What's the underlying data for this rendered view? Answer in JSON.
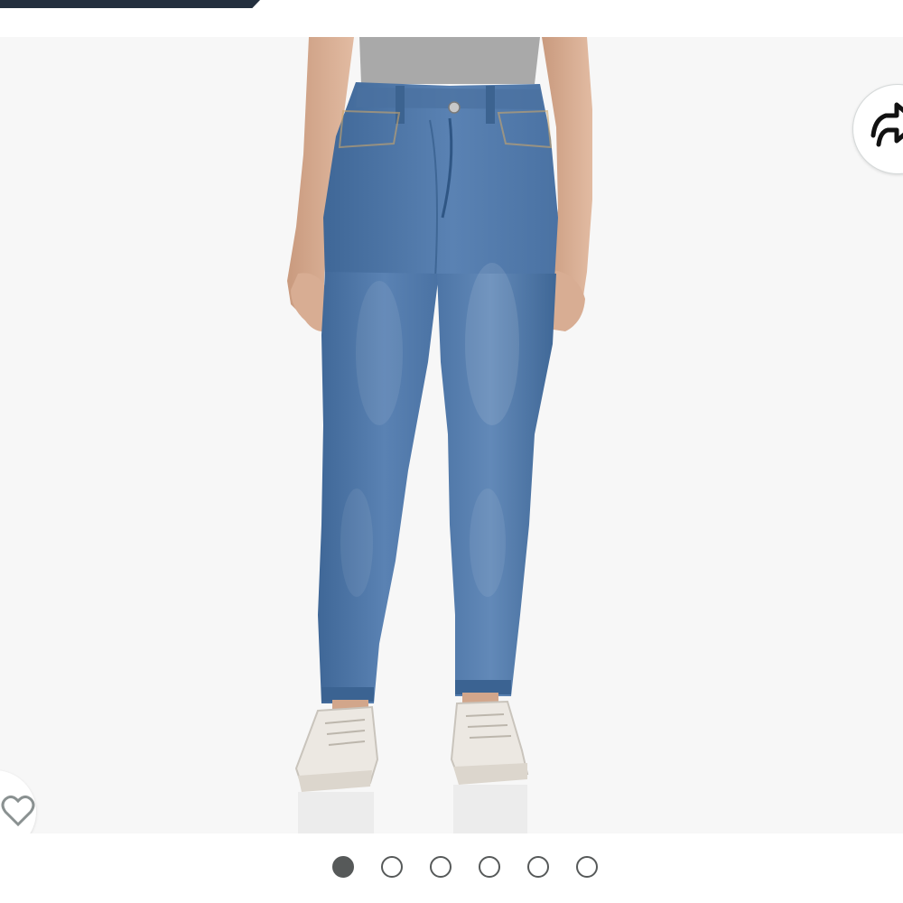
{
  "header": {
    "bar_color": "#232f3e"
  },
  "gallery": {
    "image_subject": "high-rise-skinny-jeans-photo",
    "background_color": "#f7f7f7",
    "denim_color": "#5077a8",
    "share_icon": "share-icon",
    "wishlist_icon": "heart-icon",
    "image_count": 6,
    "active_index": 0
  }
}
